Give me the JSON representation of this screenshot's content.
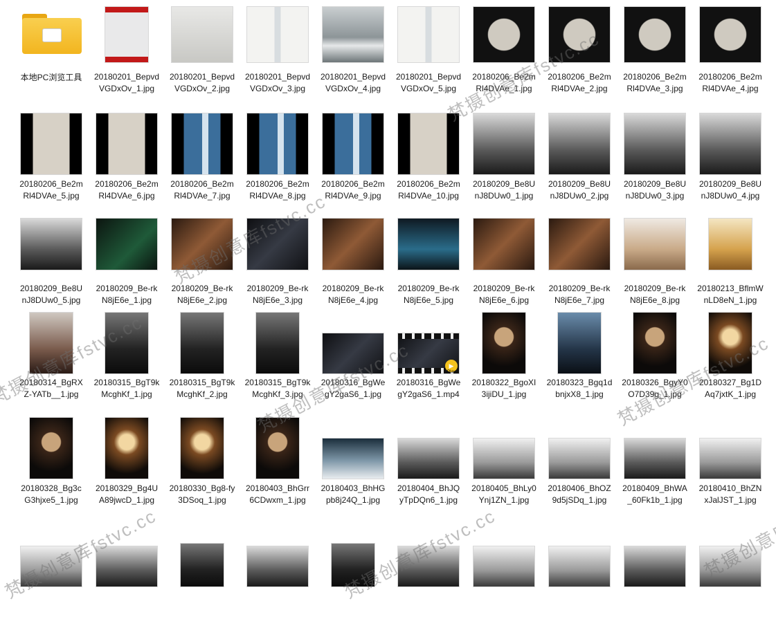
{
  "folder": {
    "label": "本地PC浏览工具"
  },
  "video_badge": "Player",
  "watermark_text": "梵摄创意库fstvc.cc",
  "files": [
    {
      "name": "20180201_BepvdVGDxOv_1.jpg",
      "type": "image",
      "tone": "time"
    },
    {
      "name": "20180201_BepvdVGDxOv_2.jpg",
      "type": "image",
      "tone": "grayLight"
    },
    {
      "name": "20180201_BepvdVGDxOv_3.jpg",
      "type": "image",
      "tone": "spread"
    },
    {
      "name": "20180201_BepvdVGDxOv_4.jpg",
      "type": "image",
      "tone": "ice"
    },
    {
      "name": "20180201_BepvdVGDxOv_5.jpg",
      "type": "image",
      "tone": "spread"
    },
    {
      "name": "20180206_Be2mRl4DVAe_1.jpg",
      "type": "image",
      "tone": "darkFrame"
    },
    {
      "name": "20180206_Be2mRl4DVAe_2.jpg",
      "type": "image",
      "tone": "darkFrame"
    },
    {
      "name": "20180206_Be2mRl4DVAe_3.jpg",
      "type": "image",
      "tone": "darkFrame"
    },
    {
      "name": "20180206_Be2mRl4DVAe_4.jpg",
      "type": "image",
      "tone": "darkFrame"
    },
    {
      "name": "20180206_Be2mRl4DVAe_5.jpg",
      "type": "image",
      "tone": "darkSand"
    },
    {
      "name": "20180206_Be2mRl4DVAe_6.jpg",
      "type": "image",
      "tone": "darkSand"
    },
    {
      "name": "20180206_Be2mRl4DVAe_7.jpg",
      "type": "image",
      "tone": "darkBlue"
    },
    {
      "name": "20180206_Be2mRl4DVAe_8.jpg",
      "type": "image",
      "tone": "darkBlue"
    },
    {
      "name": "20180206_Be2mRl4DVAe_9.jpg",
      "type": "image",
      "tone": "darkBlue"
    },
    {
      "name": "20180206_Be2mRl4DVAe_10.jpg",
      "type": "image",
      "tone": "darkSand"
    },
    {
      "name": "20180209_Be8UnJ8DUw0_1.jpg",
      "type": "image",
      "tone": "bw"
    },
    {
      "name": "20180209_Be8UnJ8DUw0_2.jpg",
      "type": "image",
      "tone": "bw"
    },
    {
      "name": "20180209_Be8UnJ8DUw0_3.jpg",
      "type": "image",
      "tone": "bw"
    },
    {
      "name": "20180209_Be8UnJ8DUw0_4.jpg",
      "type": "image",
      "tone": "bw"
    },
    {
      "name": "20180209_Be8UnJ8DUw0_5.jpg",
      "type": "image",
      "tone": "bw"
    },
    {
      "name": "20180209_Be-rkN8jE6e_1.jpg",
      "type": "image",
      "tone": "green"
    },
    {
      "name": "20180209_Be-rkN8jE6e_2.jpg",
      "type": "image",
      "tone": "warm"
    },
    {
      "name": "20180209_Be-rkN8jE6e_3.jpg",
      "type": "image",
      "tone": "dim"
    },
    {
      "name": "20180209_Be-rkN8jE6e_4.jpg",
      "type": "image",
      "tone": "warm"
    },
    {
      "name": "20180209_Be-rkN8jE6e_5.jpg",
      "type": "image",
      "tone": "teal"
    },
    {
      "name": "20180209_Be-rkN8jE6e_6.jpg",
      "type": "image",
      "tone": "warm"
    },
    {
      "name": "20180209_Be-rkN8jE6e_7.jpg",
      "type": "image",
      "tone": "warm"
    },
    {
      "name": "20180209_Be-rkN8jE6e_8.jpg",
      "type": "image",
      "tone": "sand"
    },
    {
      "name": "20180213_BflmWnLD8eN_1.jpg",
      "type": "image",
      "tone": "gold"
    },
    {
      "name": "20180314_BgRXZ-YATb__1.jpg",
      "type": "image",
      "tone": "smoke"
    },
    {
      "name": "20180315_BgT9kMcghKf_1.jpg",
      "type": "image",
      "tone": "bwDark"
    },
    {
      "name": "20180315_BgT9kMcghKf_2.jpg",
      "type": "image",
      "tone": "bwDark"
    },
    {
      "name": "20180315_BgT9kMcghKf_3.jpg",
      "type": "image",
      "tone": "bwDark"
    },
    {
      "name": "20180316_BgWegY2gaS6_1.jpg",
      "type": "image",
      "tone": "dim"
    },
    {
      "name": "20180316_BgWegY2gaS6_1.mp4",
      "type": "video",
      "tone": "dim"
    },
    {
      "name": "20180322_BgoXI3ijiDU_1.jpg",
      "type": "image",
      "tone": "portrait"
    },
    {
      "name": "20180323_Bgq1dbnjxX8_1.jpg",
      "type": "image",
      "tone": "portraitBlue"
    },
    {
      "name": "20180326_BgyY0O7D39g_1.jpg",
      "type": "image",
      "tone": "portrait"
    },
    {
      "name": "20180327_Bg1DAq7jxtK_1.jpg",
      "type": "image",
      "tone": "portraitWarm"
    },
    {
      "name": "20180328_Bg3cG3hjxe5_1.jpg",
      "type": "image",
      "tone": "portrait"
    },
    {
      "name": "20180329_Bg4UA89jwcD_1.jpg",
      "type": "image",
      "tone": "portraitWarm"
    },
    {
      "name": "20180330_Bg8-fy3DSoq_1.jpg",
      "type": "image",
      "tone": "portraitWarm"
    },
    {
      "name": "20180403_BhGrr6CDwxm_1.jpg",
      "type": "image",
      "tone": "portrait"
    },
    {
      "name": "20180403_BhHGpb8j24Q_1.jpg",
      "type": "image",
      "tone": "sky"
    },
    {
      "name": "20180404_BhJQyTpDQn6_1.jpg",
      "type": "image",
      "tone": "bw"
    },
    {
      "name": "20180405_BhLy0Ynj1ZN_1.jpg",
      "type": "image",
      "tone": "bwLight"
    },
    {
      "name": "20180406_BhOZ9d5jSDq_1.jpg",
      "type": "image",
      "tone": "bwLight"
    },
    {
      "name": "20180409_BhWA_60Fk1b_1.jpg",
      "type": "image",
      "tone": "bw"
    },
    {
      "name": "20180410_BhZNxJalJST_1.jpg",
      "type": "image",
      "tone": "bwLight"
    },
    {
      "name": "",
      "type": "image",
      "tone": "bwLight"
    },
    {
      "name": "",
      "type": "image",
      "tone": "bw"
    },
    {
      "name": "",
      "type": "image",
      "tone": "bwDark"
    },
    {
      "name": "",
      "type": "image",
      "tone": "bw"
    },
    {
      "name": "",
      "type": "image",
      "tone": "bwDark"
    },
    {
      "name": "",
      "type": "image",
      "tone": "bw"
    },
    {
      "name": "",
      "type": "image",
      "tone": "bwLight"
    },
    {
      "name": "",
      "type": "image",
      "tone": "bwLight"
    },
    {
      "name": "",
      "type": "image",
      "tone": "bw"
    },
    {
      "name": "",
      "type": "image",
      "tone": "bwLight"
    },
    {
      "name": "",
      "type": "image",
      "tone": "portraitWarm"
    }
  ]
}
